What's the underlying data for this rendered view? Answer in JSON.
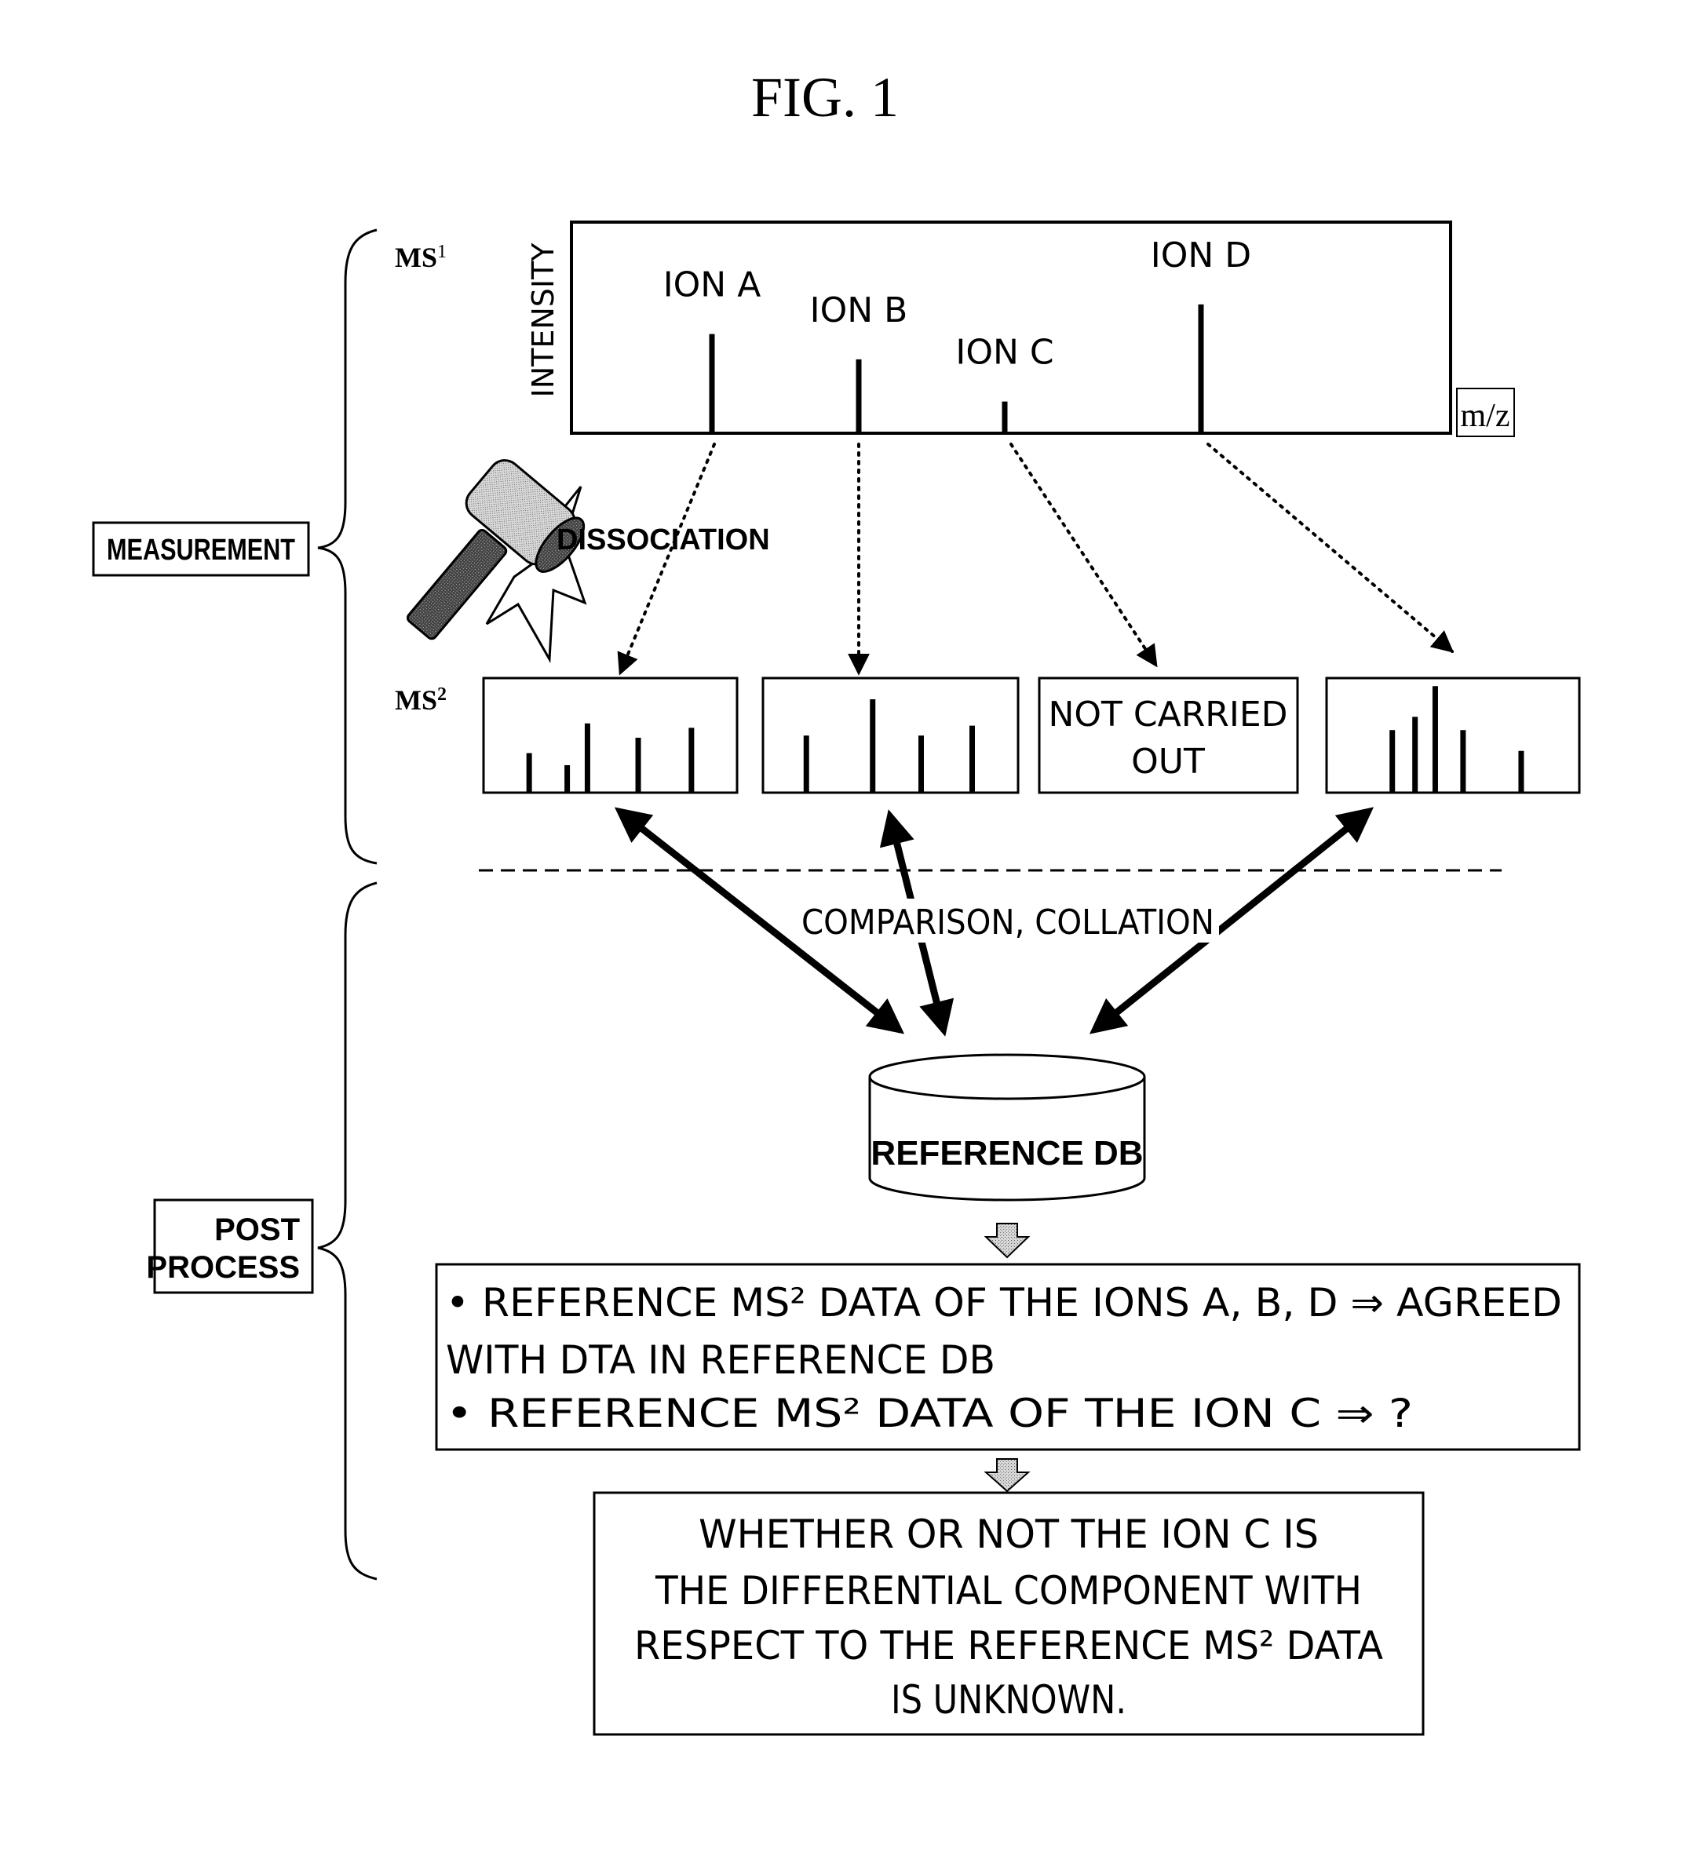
{
  "figure": {
    "title": "FIG. 1"
  },
  "phases": {
    "measurement_label": "MEASUREMENT",
    "post_process_label_line1": "POST",
    "post_process_label_line2": "PROCESS"
  },
  "ms1": {
    "label": "MS",
    "label_superscript": "1",
    "y_axis_label": "INTENSITY",
    "x_axis_label": "m/z",
    "peaks": [
      {
        "name": "ION A",
        "relative_intensity": 0.47
      },
      {
        "name": "ION B",
        "relative_intensity": 0.35
      },
      {
        "name": "ION C",
        "relative_intensity": 0.15
      },
      {
        "name": "ION D",
        "relative_intensity": 0.61
      }
    ]
  },
  "dissociation": {
    "label": "DISSOCIATION"
  },
  "ms2": {
    "label": "MS",
    "label_superscript": "2",
    "spectra": [
      {
        "ion": "ION A",
        "carried_out": true,
        "peaks": [
          0.36,
          0.25,
          0.63,
          0.5,
          0.59
        ]
      },
      {
        "ion": "ION B",
        "carried_out": true,
        "peaks": [
          0.52,
          0.85,
          0.52,
          0.61
        ]
      },
      {
        "ion": "ION C",
        "carried_out": false,
        "text_line1": "NOT CARRIED",
        "text_line2": "OUT"
      },
      {
        "ion": "ION D",
        "carried_out": true,
        "peaks": [
          0.57,
          0.69,
          0.97,
          0.57,
          0.38
        ]
      }
    ]
  },
  "comparison": {
    "label": "COMPARISON, COLLATION"
  },
  "database": {
    "label": "REFERENCE DB"
  },
  "result_box": {
    "line1": "• REFERENCE MS² DATA OF THE IONS A,  B,  D ⇒ AGREED",
    "line2": "WITH DTA IN REFERENCE DB",
    "line3": "• REFERENCE MS² DATA OF THE ION C       ⇒  ?"
  },
  "conclusion_box": {
    "line1": "WHETHER OR NOT THE ION C IS",
    "line2": "THE DIFFERENTIAL COMPONENT WITH",
    "line3": "RESPECT TO THE REFERENCE MS² DATA",
    "line4": "IS UNKNOWN."
  }
}
